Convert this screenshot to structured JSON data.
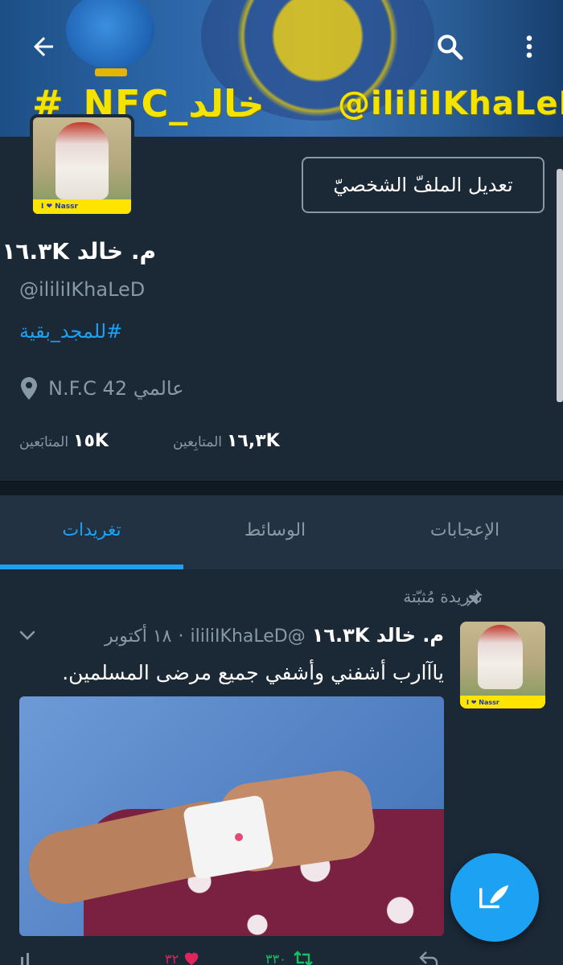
{
  "banner": {
    "hashtag_text": "#_NFC_خالد",
    "handle_text": "@ililiIKhaLeD"
  },
  "topbar": {
    "back_icon": "arrow-left-icon",
    "search_icon": "search-icon",
    "more_icon": "more-vertical-icon"
  },
  "profile": {
    "avatar_label": "I ❤ Nassr",
    "edit_button_label": "تعديل الملفّ الشخصيّ",
    "name": "م. خالد ١٦.٣K",
    "handle": "@ililiIKhaLeD",
    "bio": "#للمجد_بقية",
    "location_icon": "location-pin-icon",
    "location": "عالمي N.F.C 42",
    "followers_count": "١٦,٣K",
    "followers_label": "المتابِعين",
    "following_count": "١٥K",
    "following_label": "المتابَعين"
  },
  "tabs": {
    "tweets": "تغريدات",
    "media": "الوسائط",
    "likes": "الإعجابات",
    "active": "tweets"
  },
  "tweet": {
    "pinned_label": "تغريدة مُثبّتة",
    "author_name": "م. خالد ١٦.٣K",
    "author_handle": "@ililiIKhaLeD",
    "date": "١٨ أكتوبر",
    "separator": "·",
    "text": "ياآارب أشفني وأشفي جميع مرضى المسلمين.",
    "avatar_label": "I ❤ Nassr",
    "likes": "٣٢",
    "retweets": "٣٣٠"
  },
  "fab": {
    "icon": "compose-tweet-icon"
  },
  "colors": {
    "background": "#1b2836",
    "accent": "#1da1f2",
    "muted": "#8899a6",
    "like": "#e0245e",
    "retweet": "#17bf63"
  }
}
